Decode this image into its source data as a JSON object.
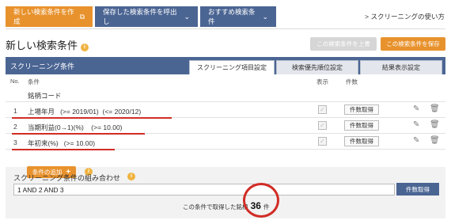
{
  "nav": {
    "new_label": "新しい検索条件を作成",
    "load_label": "保存した検索条件を呼出し",
    "recommend_label": "おすすめ検索条件",
    "howto_label": "> スクリーニングの使い方"
  },
  "page": {
    "title": "新しい検索条件",
    "overwrite_label": "この検索条件を上書",
    "save_label": "この検索条件を保存"
  },
  "panel": {
    "title": "スクリーニング条件",
    "tabs": [
      "スクリーニング項目設定",
      "検索優先順位設定",
      "結果表示設定"
    ],
    "columns": {
      "no": "No.",
      "condition": "条件",
      "display": "表示",
      "count": "件数"
    },
    "fixed_row": "銘柄コード",
    "rows": [
      {
        "no": "1",
        "condition": "上場年月   (>= 2019/01)  (<= 2020/12)",
        "count_label": "件数取得"
      },
      {
        "no": "2",
        "condition": "当期利益(0→1)(%)    (>= 10.00)",
        "count_label": "件数取得"
      },
      {
        "no": "3",
        "condition": "年初来(%)   (>= 10.00)",
        "count_label": "件数取得"
      }
    ],
    "add_label": "条件の追加",
    "info_icon": "i"
  },
  "combination": {
    "label": "スクリーニング条件の組み合わせ",
    "value": "1 AND 2 AND 3",
    "button_label": "件数取得",
    "result_prefix": "この条件で取得した銘柄",
    "result_count": "36",
    "result_suffix": "件"
  },
  "colors": {
    "orange": "#e8922d",
    "navy": "#4b6593",
    "annotation_red": "#d12d26"
  }
}
